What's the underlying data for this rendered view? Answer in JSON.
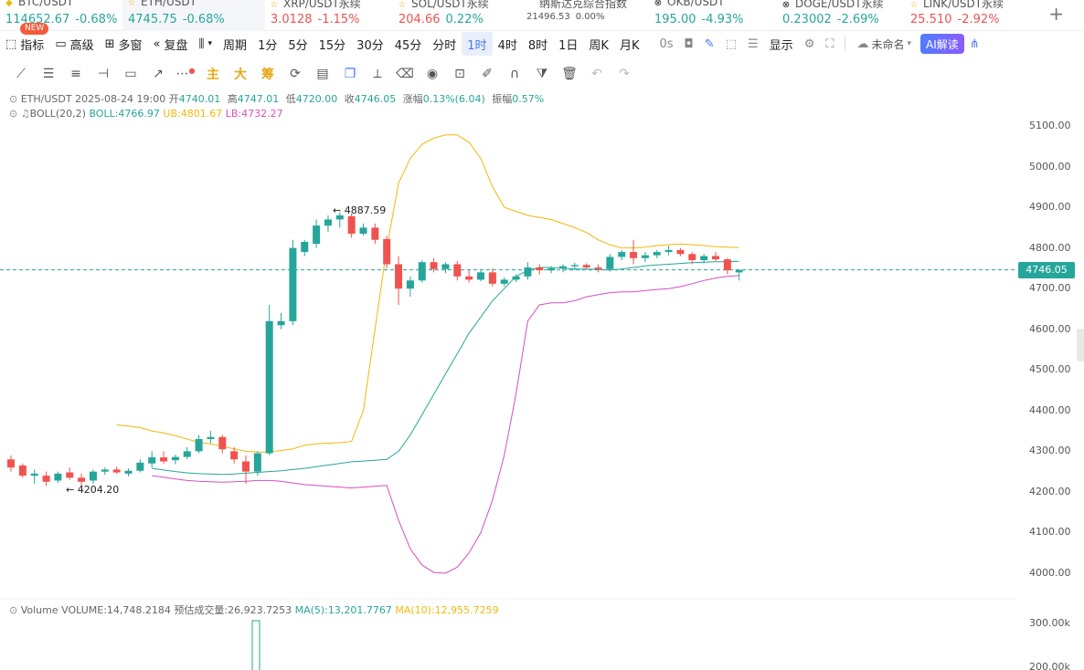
{
  "tickers": [
    {
      "name": "BTC/USDT",
      "prefix": "◆",
      "price": "114652.67",
      "change": "-0.68%",
      "price_dir": "up",
      "change_dir": "up",
      "width": 134
    },
    {
      "name": "ETH/USDT",
      "prefix": "☆",
      "price": "4745.75",
      "change": "-0.68%",
      "price_dir": "up",
      "change_dir": "up",
      "width": 156,
      "active": true
    },
    {
      "name": "XRP/USDT永续",
      "prefix": "☆",
      "price": "3.0128",
      "change": "-1.15%",
      "price_dir": "down",
      "change_dir": "down",
      "width": 140
    },
    {
      "name": "SOL/USDT永续",
      "prefix": "☆",
      "price": "204.66",
      "change": "0.22%",
      "price_dir": "down",
      "change_dir": "up",
      "width": 140
    },
    {
      "name": "纳斯达克综合指数",
      "prefix": "",
      "price": "21496.53",
      "change": "0.00%",
      "price_dir": "neutral",
      "change_dir": "neutral",
      "width": 140,
      "small": true
    },
    {
      "name": "OKB/USDT",
      "prefix": "⊗",
      "price": "195.00",
      "change": "-4.93%",
      "price_dir": "up",
      "change_dir": "up",
      "width": 140
    },
    {
      "name": "DOGE/USDT永续",
      "prefix": "⊗",
      "price": "0.23002",
      "change": "-2.69%",
      "price_dir": "up",
      "change_dir": "up",
      "width": 140
    },
    {
      "name": "LINK/USDT永续",
      "prefix": "☆",
      "price": "25.510",
      "change": "-2.92%",
      "price_dir": "down",
      "change_dir": "down",
      "width": 140
    }
  ],
  "toolbar": {
    "indicator": "指标",
    "new_badge": "NEW",
    "advanced": "高级",
    "multi_window": "多窗",
    "replay": "复盘",
    "period_label": "周期",
    "periods": [
      "1分",
      "5分",
      "15分",
      "30分",
      "45分",
      "分时",
      "1时",
      "4时",
      "8时",
      "1日",
      "周K",
      "月K"
    ],
    "selected_period": "1时",
    "countdown": "0s",
    "display": "显示",
    "unnamed": "未命名",
    "ai": "AI解读"
  },
  "drawbar": {
    "main": "主",
    "big": "大",
    "chips": "筹"
  },
  "chart_info": {
    "symbol_line": {
      "symbol": "ETH/USDT",
      "datetime": "2025-08-24 19:00",
      "open_label": "开",
      "open": "4740.01",
      "high_label": "高",
      "high": "4747.01",
      "low_label": "低",
      "low": "4720.00",
      "close_label": "收",
      "close": "4746.05",
      "change_label": "涨幅",
      "change": "0.13%(6.04)",
      "amplitude_label": "振幅",
      "amplitude": "0.57%"
    },
    "boll_line": {
      "name": "BOLL(20,2)",
      "boll": "BOLL:4766.97",
      "ub": "UB:4801.67",
      "lb": "LB:4732.27"
    },
    "volume_line": {
      "name": "Volume",
      "volume": "VOLUME:14,748.2184",
      "est": "预估成交量:26,923.7253",
      "ma5": "MA(5):13,201.7767",
      "ma10": "MA(10):12,955.7259"
    },
    "current_price": "4746.05",
    "annotation_high": "← 4887.59",
    "annotation_low": "← 4204.20"
  },
  "y_axis": [
    "5100.00",
    "5000.00",
    "4900.00",
    "4800.00",
    "4700.00",
    "4600.00",
    "4500.00",
    "4400.00",
    "4300.00",
    "4200.00",
    "4100.00",
    "4000.00"
  ],
  "volume_axis": [
    "300.00k",
    "200.00k"
  ],
  "colors": {
    "up": "#26a69a",
    "down": "#ef5350",
    "ub": "#f0b90b",
    "lb": "#d54fbf",
    "mid": "#26a69a",
    "accent": "#4a78f0"
  },
  "chart_data": {
    "type": "candlestick",
    "y_range": [
      4000,
      5100
    ],
    "candles": [
      [
        4280,
        4290,
        4250,
        4260
      ],
      [
        4265,
        4270,
        4235,
        4240
      ],
      [
        4240,
        4255,
        4220,
        4245
      ],
      [
        4240,
        4250,
        4215,
        4225
      ],
      [
        4228,
        4250,
        4222,
        4245
      ],
      [
        4248,
        4260,
        4230,
        4235
      ],
      [
        4235,
        4245,
        4215,
        4225
      ],
      [
        4228,
        4255,
        4220,
        4250
      ],
      [
        4250,
        4260,
        4242,
        4255
      ],
      [
        4255,
        4262,
        4245,
        4248
      ],
      [
        4245,
        4258,
        4238,
        4252
      ],
      [
        4252,
        4280,
        4248,
        4272
      ],
      [
        4270,
        4300,
        4260,
        4285
      ],
      [
        4285,
        4300,
        4270,
        4275
      ],
      [
        4278,
        4292,
        4268,
        4286
      ],
      [
        4286,
        4310,
        4280,
        4300
      ],
      [
        4300,
        4340,
        4295,
        4330
      ],
      [
        4330,
        4350,
        4320,
        4335
      ],
      [
        4335,
        4340,
        4295,
        4305
      ],
      [
        4300,
        4310,
        4270,
        4280
      ],
      [
        4275,
        4290,
        4220,
        4250
      ],
      [
        4250,
        4300,
        4240,
        4295
      ],
      [
        4295,
        4660,
        4290,
        4620
      ],
      [
        4610,
        4640,
        4600,
        4620
      ],
      [
        4620,
        4820,
        4610,
        4800
      ],
      [
        4790,
        4820,
        4780,
        4815
      ],
      [
        4810,
        4870,
        4800,
        4855
      ],
      [
        4855,
        4880,
        4840,
        4870
      ],
      [
        4870,
        4888,
        4850,
        4880
      ],
      [
        4878,
        4885,
        4825,
        4835
      ],
      [
        4835,
        4860,
        4830,
        4850
      ],
      [
        4850,
        4860,
        4810,
        4820
      ],
      [
        4822,
        4830,
        4750,
        4760
      ],
      [
        4760,
        4780,
        4660,
        4700
      ],
      [
        4700,
        4730,
        4680,
        4720
      ],
      [
        4720,
        4770,
        4715,
        4765
      ],
      [
        4765,
        4775,
        4740,
        4748
      ],
      [
        4748,
        4765,
        4738,
        4760
      ],
      [
        4760,
        4768,
        4720,
        4730
      ],
      [
        4730,
        4745,
        4715,
        4722
      ],
      [
        4722,
        4745,
        4718,
        4740
      ],
      [
        4740,
        4750,
        4705,
        4712
      ],
      [
        4712,
        4728,
        4705,
        4722
      ],
      [
        4722,
        4735,
        4716,
        4730
      ],
      [
        4730,
        4765,
        4722,
        4752
      ],
      [
        4752,
        4760,
        4735,
        4745
      ],
      [
        4745,
        4755,
        4738,
        4750
      ],
      [
        4750,
        4760,
        4740,
        4755
      ],
      [
        4755,
        4764,
        4745,
        4758
      ],
      [
        4758,
        4762,
        4748,
        4752
      ],
      [
        4752,
        4760,
        4740,
        4748
      ],
      [
        4748,
        4785,
        4742,
        4778
      ],
      [
        4778,
        4795,
        4770,
        4790
      ],
      [
        4790,
        4820,
        4760,
        4775
      ],
      [
        4775,
        4790,
        4765,
        4782
      ],
      [
        4782,
        4795,
        4775,
        4790
      ],
      [
        4790,
        4805,
        4782,
        4795
      ],
      [
        4795,
        4800,
        4780,
        4785
      ],
      [
        4785,
        4790,
        4760,
        4770
      ],
      [
        4770,
        4785,
        4762,
        4780
      ],
      [
        4780,
        4790,
        4768,
        4772
      ],
      [
        4772,
        4775,
        4735,
        4745
      ],
      [
        4740,
        4747,
        4720,
        4746
      ]
    ],
    "bollinger": {
      "ub": [
        4365,
        4362,
        4358,
        4350,
        4345,
        4338,
        4330,
        4322,
        4318,
        4312,
        4306,
        4300,
        4298,
        4298,
        4302,
        4306,
        4315,
        4318,
        4320,
        4321,
        4324,
        4400,
        4600,
        4800,
        4960,
        5020,
        5055,
        5070,
        5078,
        5078,
        5060,
        5020,
        4950,
        4900,
        4890,
        4880,
        4875,
        4870,
        4860,
        4850,
        4838,
        4820,
        4808,
        4800,
        4800,
        4802,
        4806,
        4808,
        4810,
        4808,
        4806,
        4803,
        4802,
        4801
      ],
      "mid": [
        4258,
        4254,
        4250,
        4247,
        4245,
        4244,
        4243,
        4244,
        4246,
        4248,
        4250,
        4252,
        4255,
        4258,
        4262,
        4266,
        4270,
        4274,
        4276,
        4278,
        4280,
        4300,
        4340,
        4390,
        4440,
        4490,
        4540,
        4590,
        4630,
        4670,
        4700,
        4730,
        4745,
        4752,
        4752,
        4750,
        4748,
        4748,
        4747,
        4746,
        4748,
        4752,
        4756,
        4758,
        4760,
        4762,
        4764,
        4765,
        4766,
        4766,
        4767
      ],
      "lb": [
        4240,
        4236,
        4232,
        4228,
        4226,
        4225,
        4224,
        4225,
        4226,
        4228,
        4228,
        4226,
        4222,
        4218,
        4216,
        4214,
        4212,
        4210,
        4212,
        4214,
        4216,
        4130,
        4060,
        4020,
        4002,
        4000,
        4015,
        4050,
        4100,
        4180,
        4290,
        4440,
        4620,
        4660,
        4665,
        4665,
        4670,
        4680,
        4685,
        4690,
        4692,
        4692,
        4695,
        4698,
        4700,
        4705,
        4712,
        4720,
        4726,
        4730,
        4732
      ]
    }
  }
}
